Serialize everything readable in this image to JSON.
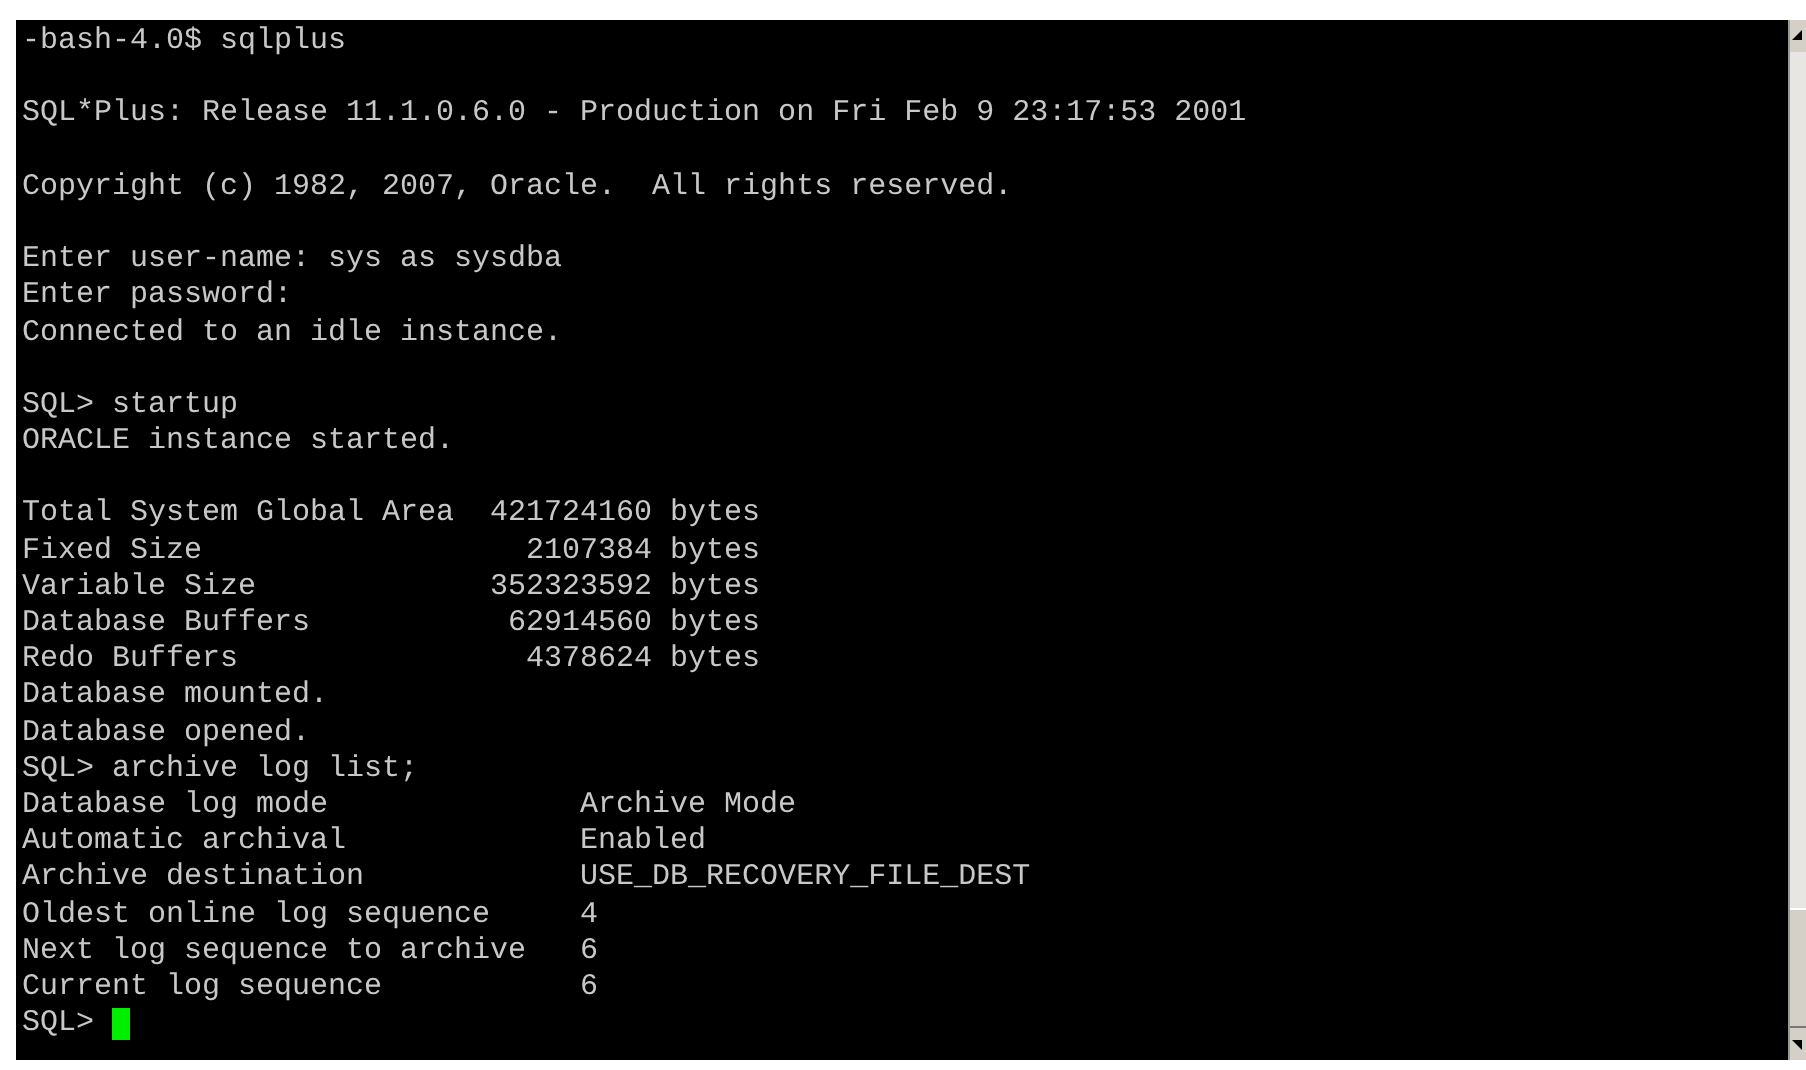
{
  "terminal": {
    "lines": [
      {
        "kind": "text",
        "text": "-bash-4.0$ sqlplus"
      },
      {
        "kind": "blank"
      },
      {
        "kind": "text",
        "text": "SQL*Plus: Release 11.1.0.6.0 - Production on Fri Feb 9 23:17:53 2001"
      },
      {
        "kind": "blank"
      },
      {
        "kind": "text",
        "text": "Copyright (c) 1982, 2007, Oracle.  All rights reserved."
      },
      {
        "kind": "blank"
      },
      {
        "kind": "text",
        "text": "Enter user-name: sys as sysdba"
      },
      {
        "kind": "text",
        "text": "Enter password:"
      },
      {
        "kind": "text",
        "text": "Connected to an idle instance."
      },
      {
        "kind": "blank"
      },
      {
        "kind": "text",
        "text": "SQL> startup"
      },
      {
        "kind": "text",
        "text": "ORACLE instance started."
      },
      {
        "kind": "blank"
      },
      {
        "kind": "text",
        "text": "Total System Global Area  421724160 bytes"
      },
      {
        "kind": "text",
        "text": "Fixed Size                  2107384 bytes"
      },
      {
        "kind": "text",
        "text": "Variable Size             352323592 bytes"
      },
      {
        "kind": "text",
        "text": "Database Buffers           62914560 bytes"
      },
      {
        "kind": "text",
        "text": "Redo Buffers                4378624 bytes"
      },
      {
        "kind": "text",
        "text": "Database mounted."
      },
      {
        "kind": "text",
        "text": "Database opened."
      },
      {
        "kind": "text",
        "text": "SQL> archive log list;"
      },
      {
        "kind": "text",
        "text": "Database log mode              Archive Mode"
      },
      {
        "kind": "text",
        "text": "Automatic archival             Enabled"
      },
      {
        "kind": "text",
        "text": "Archive destination            USE_DB_RECOVERY_FILE_DEST"
      },
      {
        "kind": "text",
        "text": "Oldest online log sequence     4"
      },
      {
        "kind": "text",
        "text": "Next log sequence to archive   6"
      },
      {
        "kind": "text",
        "text": "Current log sequence           6"
      },
      {
        "kind": "prompt",
        "text": "SQL>"
      }
    ]
  }
}
